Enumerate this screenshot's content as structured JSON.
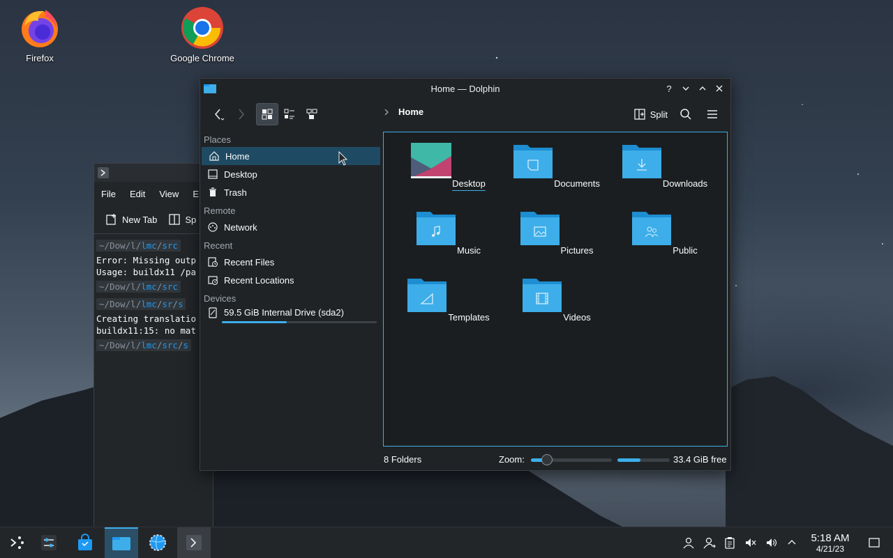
{
  "desktop": {
    "icons": [
      {
        "label": "Firefox"
      },
      {
        "label": "Google Chrome"
      }
    ]
  },
  "konsole": {
    "menu": [
      "File",
      "Edit",
      "View",
      "E"
    ],
    "toolbar": {
      "new_tab": "New Tab",
      "split": "Sp"
    },
    "lines": [
      {
        "type": "prompt",
        "tilde": "~",
        "parts": [
          "Dow",
          "l",
          "lmc",
          "src"
        ]
      },
      {
        "type": "text",
        "text": "Error: Missing outp"
      },
      {
        "type": "text",
        "text": "Usage: buildx11 /pa"
      },
      {
        "type": "prompt",
        "tilde": "~",
        "parts": [
          "Dow",
          "l",
          "lmc",
          "src"
        ]
      },
      {
        "type": "prompt",
        "tilde": "~",
        "parts": [
          "Dow",
          "l",
          "lmc",
          "sr",
          "s"
        ]
      },
      {
        "type": "text",
        "text": "Creating translatio"
      },
      {
        "type": "text",
        "text": "buildx11:15: no mat"
      },
      {
        "type": "prompt",
        "tilde": "~",
        "parts": [
          "Dow",
          "l",
          "lmc",
          "src",
          "s"
        ]
      }
    ]
  },
  "dolphin": {
    "title": "Home — Dolphin",
    "controls": {
      "help": "?",
      "minimize": "⌄",
      "maximize": "⌃",
      "close": "✕"
    },
    "breadcrumb": "Home",
    "split_label": "Split",
    "places": {
      "sections": [
        {
          "title": "Places",
          "items": [
            {
              "label": "Home",
              "icon": "home-icon",
              "selected": true
            },
            {
              "label": "Desktop",
              "icon": "desktop-icon"
            },
            {
              "label": "Trash",
              "icon": "trash-icon"
            }
          ]
        },
        {
          "title": "Remote",
          "items": [
            {
              "label": "Network",
              "icon": "network-icon"
            }
          ]
        },
        {
          "title": "Recent",
          "items": [
            {
              "label": "Recent Files",
              "icon": "recent-files-icon"
            },
            {
              "label": "Recent Locations",
              "icon": "recent-locations-icon"
            }
          ]
        },
        {
          "title": "Devices",
          "items": [
            {
              "label": "59.5 GiB Internal Drive (sda2)",
              "icon": "drive-icon",
              "usage": 0.42
            }
          ]
        }
      ]
    },
    "folders": [
      {
        "label": "Desktop",
        "icon": "desktop-folder-icon",
        "selected": true
      },
      {
        "label": "Documents",
        "icon": "documents-folder-icon"
      },
      {
        "label": "Downloads",
        "icon": "downloads-folder-icon"
      },
      {
        "label": "Music",
        "icon": "music-folder-icon"
      },
      {
        "label": "Pictures",
        "icon": "pictures-folder-icon"
      },
      {
        "label": "Public",
        "icon": "public-folder-icon"
      },
      {
        "label": "Templates",
        "icon": "templates-folder-icon"
      },
      {
        "label": "Videos",
        "icon": "videos-folder-icon"
      }
    ],
    "status": {
      "count": "8 Folders",
      "zoom_label": "Zoom:",
      "zoom_level": 0.2,
      "free_fraction": 0.44,
      "free_text": "33.4 GiB free"
    }
  },
  "taskbar": {
    "clock_time": "5:18 AM",
    "clock_date": "4/21/23"
  },
  "colors": {
    "accent": "#3daee9",
    "window_bg": "#202326",
    "selection": "#1f4a63"
  }
}
